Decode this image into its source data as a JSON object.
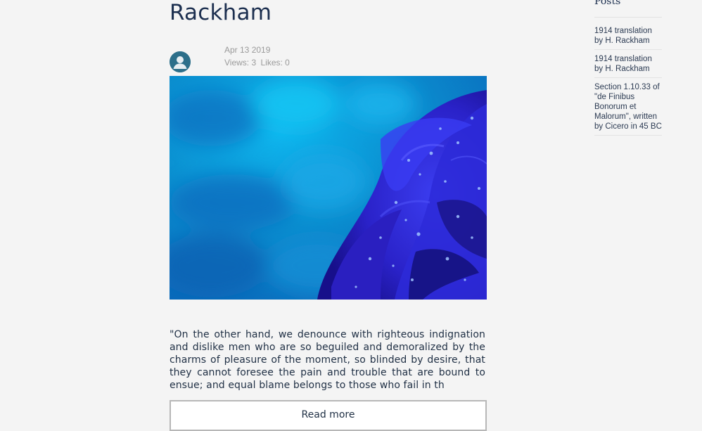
{
  "post": {
    "title": "Rackham",
    "date": "Apr 13 2019",
    "views": "Views: 3",
    "likes": "Likes: 0",
    "excerpt": "\"On the other hand, we denounce with righteous indignation and dislike men who are so beguiled and demoralized by the charms of pleasure of the moment, so blinded by desire, that they cannot foresee the pain and trouble that are bound to ensue; and equal blame belongs to those who fail in th",
    "read_more_label": "Read more"
  },
  "sidebar": {
    "heading": "Posts",
    "items": [
      {
        "label": "1914 translation by H. Rackham"
      },
      {
        "label": "1914 translation by H. Rackham"
      },
      {
        "label": "Section 1.10.33 of \"de Finibus Bonorum et Malorum\", written by Cicero in 45 BC"
      }
    ]
  },
  "colors": {
    "page_background": "#f4f4f4",
    "title_text": "#1c2f4f",
    "meta_text": "#9a9a9a",
    "avatar_background": "#2c6f8a",
    "button_border": "#b7b7b7"
  },
  "icons": {
    "avatar": "user-silhouette-icon"
  }
}
